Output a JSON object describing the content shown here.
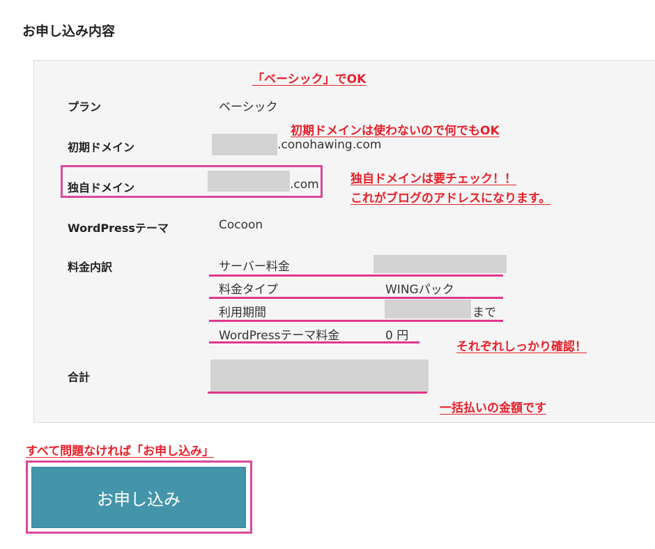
{
  "section_title": "お申し込み内容",
  "rows": {
    "plan": {
      "label": "プラン",
      "value": "ベーシック"
    },
    "initial_domain": {
      "label": "初期ドメイン",
      "value": ".conohawing.com"
    },
    "own_domain": {
      "label": "独自ドメイン",
      "value": ".com"
    },
    "theme": {
      "label": "WordPressテーマ",
      "value": "Cocoon"
    },
    "breakdown": {
      "label": "料金内訳",
      "items": [
        {
          "name": "サーバー料金",
          "value": ""
        },
        {
          "name": "料金タイプ",
          "value": "WINGパック"
        },
        {
          "name": "利用期間",
          "value": "まで"
        },
        {
          "name": "WordPressテーマ料金",
          "value": "0 円"
        }
      ]
    },
    "total": {
      "label": "合計"
    }
  },
  "annotations": {
    "plan_note": "「ベーシック」でOK",
    "initial_domain_note": "初期ドメインは使わないので何でもOK",
    "own_domain_note_1": "独自ドメインは要チェック！！",
    "own_domain_note_2": "これがブログのアドレスになります。",
    "breakdown_note": "それぞれしっかり確認！",
    "total_note": "一括払いの金額です",
    "apply_note": "すべて問題なければ「お申し込み」"
  },
  "apply_button_label": "お申し込み",
  "colors": {
    "accent_button": "#4495aa",
    "annotation_red": "#e8202a",
    "highlight_pink": "#e0368e"
  }
}
